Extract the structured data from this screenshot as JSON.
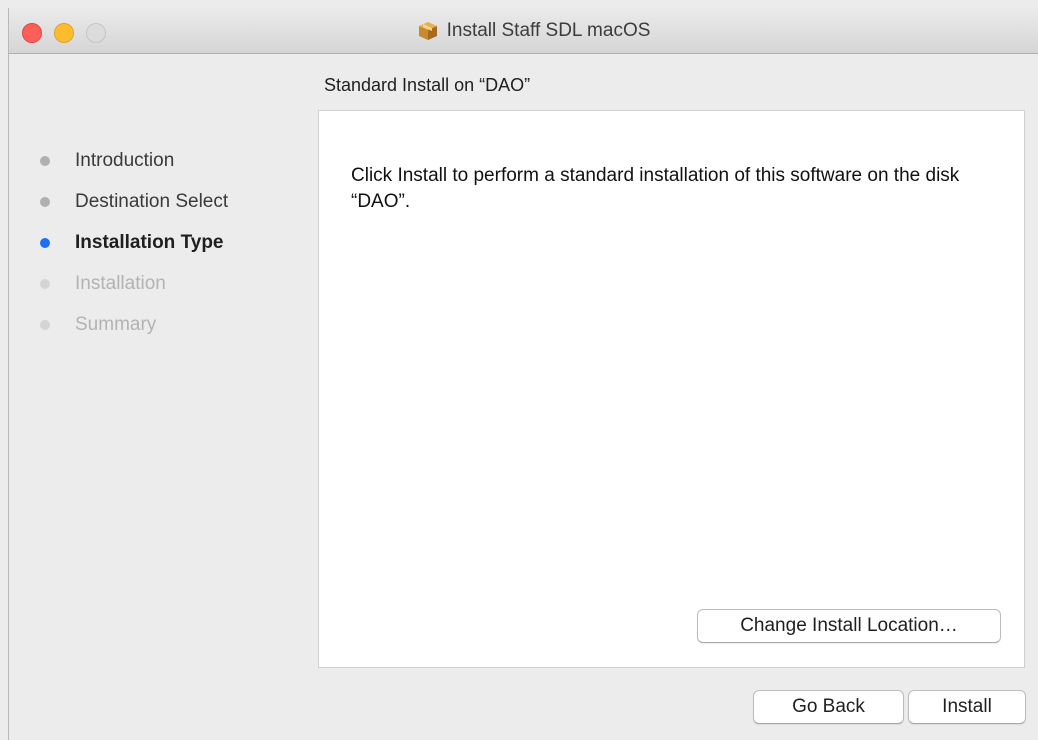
{
  "window": {
    "title": "Install Staff SDL macOS",
    "title_icon": "package-icon"
  },
  "page": {
    "subtitle": "Standard Install on “DAO”",
    "body_text": "Click Install to perform a standard installation of this software on the disk “DAO”."
  },
  "sidebar": {
    "steps": [
      {
        "label": "Introduction",
        "state": "completed"
      },
      {
        "label": "Destination Select",
        "state": "completed"
      },
      {
        "label": "Installation Type",
        "state": "current"
      },
      {
        "label": "Installation",
        "state": "pending"
      },
      {
        "label": "Summary",
        "state": "pending"
      }
    ]
  },
  "buttons": {
    "change_location": "Change Install Location…",
    "go_back": "Go Back",
    "install": "Install"
  },
  "colors": {
    "active_step_dot": "#1e6ff4",
    "close": "#fc5f57",
    "minimize": "#fdbc2e"
  }
}
